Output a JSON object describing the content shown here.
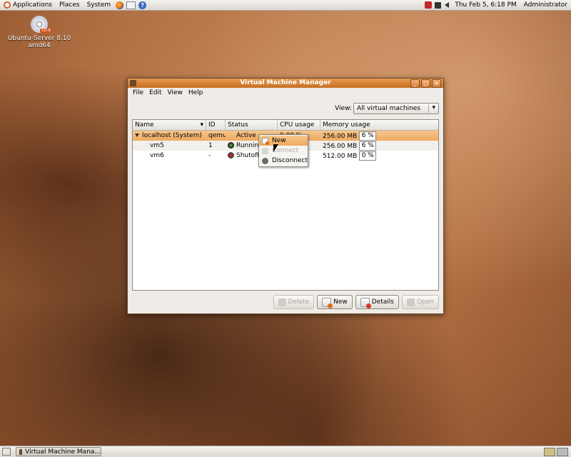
{
  "top_panel": {
    "menus": [
      "Applications",
      "Places",
      "System"
    ],
    "launchers": [
      "firefox-icon",
      "mail-icon",
      "help-icon"
    ],
    "clock": "Thu Feb  5,  6:18 PM",
    "user": "Administrator"
  },
  "desktop": {
    "icon_label_line1": "Ubuntu-Server 8.10",
    "icon_label_line2": "amd64",
    "cd_badge": "CD-R"
  },
  "window": {
    "title": "Virtual Machine Manager",
    "menu": [
      "File",
      "Edit",
      "View",
      "Help"
    ],
    "view_label": "View:",
    "view_value": "All virtual machines",
    "columns": [
      "Name",
      "ID",
      "Status",
      "CPU usage",
      "Memory usage"
    ],
    "rows": [
      {
        "name": "localhost (System)",
        "id": "qemu",
        "status": "Active",
        "cpu": "0.00 %",
        "mem": "256.00 MB",
        "mem_pct": "6 %"
      },
      {
        "name": "vm5",
        "id": "1",
        "status": "Running",
        "cpu": "",
        "mem": "256.00 MB",
        "mem_pct": "6 %"
      },
      {
        "name": "vm6",
        "id": "-",
        "status": "Shutoff",
        "cpu": "",
        "mem": "512.00 MB",
        "mem_pct": "0 %"
      }
    ],
    "buttons": {
      "delete": "Delete",
      "new": "New",
      "details": "Details",
      "open": "Open"
    }
  },
  "context_menu": {
    "items": [
      "New",
      "Connect",
      "Disconnect"
    ]
  },
  "bottom_panel": {
    "task": "Virtual Machine Mana..."
  },
  "colors": {
    "accent": "#e59a4d",
    "selection": "#f6c68c"
  }
}
